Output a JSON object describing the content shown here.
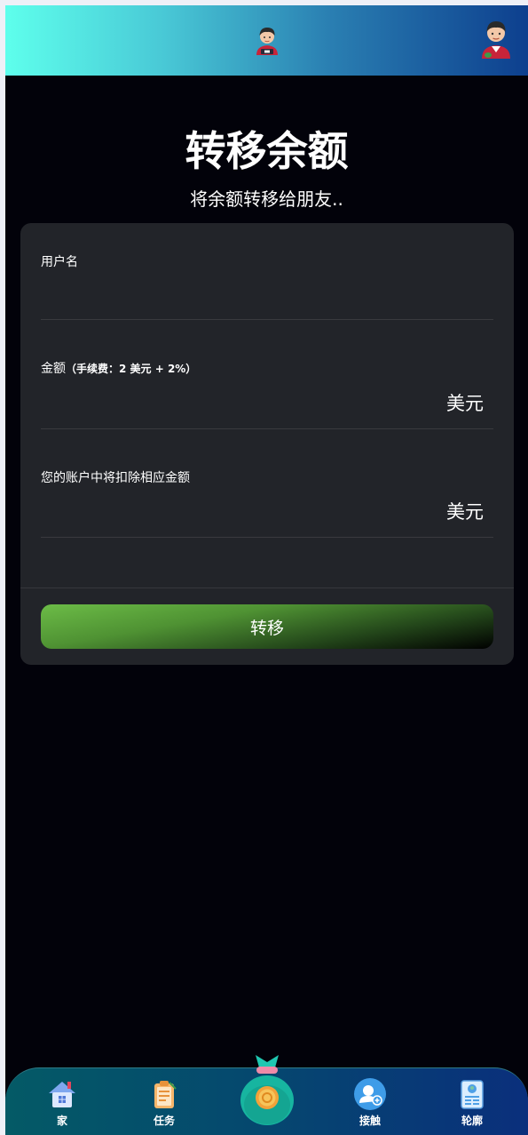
{
  "page": {
    "title": "转移余额",
    "subtitle": "将余额转移给朋友.."
  },
  "form": {
    "username": {
      "label": "用户名",
      "value": "",
      "placeholder": ""
    },
    "amount": {
      "label": "金额",
      "fee_note": "（手续费：2 美元 + 2%）",
      "value": "",
      "currency": "美元"
    },
    "deduct": {
      "label": "您的账户中将扣除相应金额",
      "value": "",
      "currency": "美元"
    },
    "submit_label": "转移"
  },
  "nav": {
    "items": [
      {
        "label": "家",
        "icon": "home-icon"
      },
      {
        "label": "任务",
        "icon": "clipboard-icon"
      },
      {
        "label": "",
        "icon": "money-bag-icon"
      },
      {
        "label": "接触",
        "icon": "add-contact-icon"
      },
      {
        "label": "轮廓",
        "icon": "profile-document-icon"
      }
    ]
  },
  "colors": {
    "background": "#02020a",
    "card": "#222429",
    "header_start": "#5effec",
    "header_end": "#0d3f8e",
    "button_green": "#6cbc47",
    "nav_start": "#045a66",
    "nav_end": "#0a2f7c"
  }
}
